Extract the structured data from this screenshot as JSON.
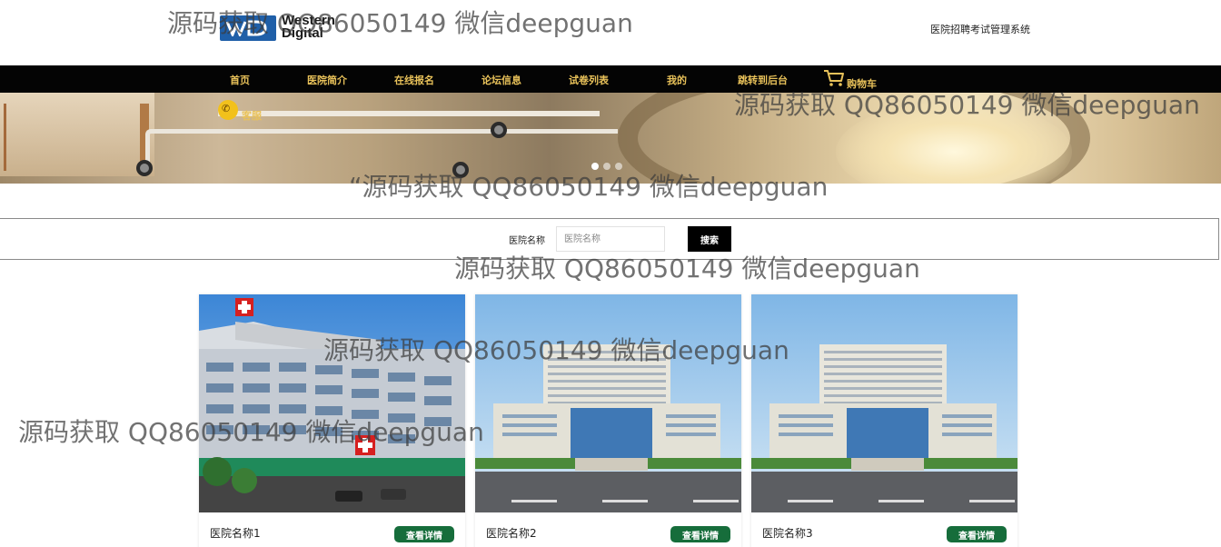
{
  "header": {
    "logo_text_line1": "Western",
    "logo_text_line2": "Digital",
    "site_title": "医院招聘考试管理系统"
  },
  "nav": {
    "items": [
      "首页",
      "医院简介",
      "在线报名",
      "论坛信息",
      "试卷列表",
      "我的",
      "跳转到后台"
    ],
    "cart_label": "购物车",
    "cart_icon": "shopping-cart-icon",
    "service_label": "客服",
    "service_icon": "wechat-icon",
    "accent_color": "#e9c25a",
    "background_color": "#040404"
  },
  "banner": {
    "slides_total": 3,
    "active_slide": 1
  },
  "search": {
    "label": "医院名称",
    "placeholder": "医院名称",
    "value": "",
    "button_label": "搜索"
  },
  "cards": [
    {
      "name": "医院名称1",
      "button_label": "查看详情"
    },
    {
      "name": "医院名称2",
      "button_label": "查看详情"
    },
    {
      "name": "医院名称3",
      "button_label": "查看详情"
    }
  ],
  "button_color": "#166d3b",
  "watermarks": [
    "源码获取 QQ86050149 微信deepguan",
    "源码获取 QQ86050149 微信deepguan",
    "“源码获取 QQ86050149 微信deepguan",
    "源码获取 QQ86050149 微信deepguan",
    "源码获取 QQ86050149 微信deepguan",
    "源码获取 QQ86050149 微信deepguan"
  ]
}
